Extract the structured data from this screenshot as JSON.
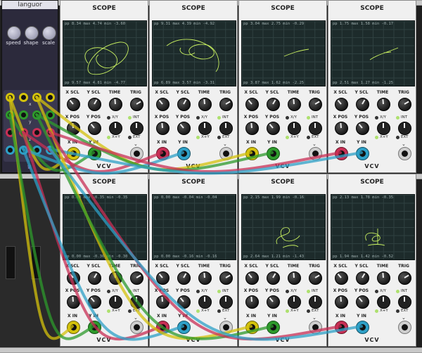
{
  "languor": {
    "title": "languor",
    "knob_labels": [
      "speed",
      "shape",
      "scale"
    ],
    "axis_labels": [
      "x",
      "y",
      "z",
      "t"
    ]
  },
  "scopes": [
    {
      "title": "SCOPE",
      "top_stats": "pp 8.34  max 4.74  min -3.60",
      "bottom_stats": "pp 9.57  max 4.81  min -4.77",
      "x_in": "yellow",
      "y_in": "green"
    },
    {
      "title": "SCOPE",
      "top_stats": "pp 9.31  max 4.39  min -4.92",
      "bottom_stats": "pp 6.89  max 3.57  min -3.31",
      "x_in": "red",
      "y_in": "blue"
    },
    {
      "title": "SCOPE",
      "top_stats": "pp 3.04  max 2.75  min -0.29",
      "bottom_stats": "pp 3.87  max 1.62  min -2.25",
      "x_in": "yellow",
      "y_in": "green"
    },
    {
      "title": "SCOPE",
      "top_stats": "pp 1.75  max 1.58  min -0.17",
      "bottom_stats": "pp 2.51  max 1.27  min -1.25",
      "x_in": "red",
      "y_in": "blue"
    },
    {
      "title": "SCOPE",
      "top_stats": "pp 0.00  max -0.35  min -0.35",
      "bottom_stats": "pp 0.00  max -0.30  min -0.30",
      "x_in": "yellow",
      "y_in": "green"
    },
    {
      "title": "SCOPE",
      "top_stats": "pp 0.00  max -0.04  min -0.04",
      "bottom_stats": "pp 0.00  max -0.16  min -0.16",
      "x_in": "red",
      "y_in": "blue"
    },
    {
      "title": "SCOPE",
      "top_stats": "pp 2.15  max 1.99  min -0.16",
      "bottom_stats": "pp 2.64  max 1.21  min -1.43",
      "x_in": "yellow",
      "y_in": "green"
    },
    {
      "title": "SCOPE",
      "top_stats": "pp 2.13  max 1.78  min -0.35",
      "bottom_stats": "pp 1.94  max 1.42  min -0.52",
      "x_in": "red",
      "y_in": "blue"
    }
  ],
  "scope_labels": {
    "x_scl": "X SCL",
    "y_scl": "Y SCL",
    "time": "TIME",
    "trig": "TRIG",
    "x_pos": "X POS",
    "y_pos": "Y POS",
    "int": "INT",
    "xy": "X/Y",
    "xpy": "X+Y",
    "ext": "EXT",
    "x_in": "X IN",
    "y_in": "Y IN",
    "brand": "VCV"
  },
  "colors": {
    "yellow": "#d4c20c",
    "green": "#2e9a2c",
    "red": "#c82f55",
    "blue": "#2ea0c7",
    "trace": "#c8f060"
  }
}
